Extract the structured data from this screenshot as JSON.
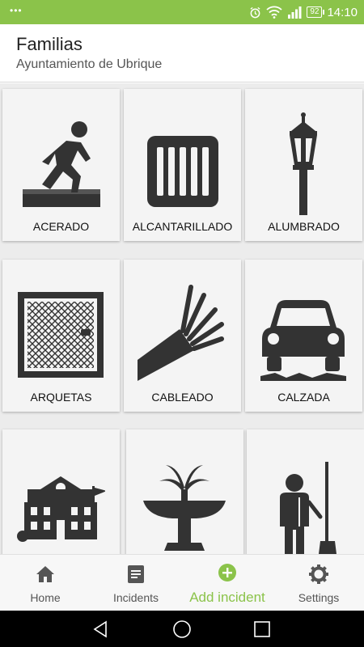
{
  "status_bar": {
    "notification_dots": "•••",
    "battery_level": "92",
    "time": "14:10"
  },
  "header": {
    "title": "Familias",
    "subtitle": "Ayuntamiento de Ubrique"
  },
  "families": [
    {
      "label": "ACERADO",
      "icon": "person-tripping-curb-icon"
    },
    {
      "label": "ALCANTARILLADO",
      "icon": "drain-grate-icon"
    },
    {
      "label": "ALUMBRADO",
      "icon": "street-lamp-icon"
    },
    {
      "label": "ARQUETAS",
      "icon": "manhole-cover-icon"
    },
    {
      "label": "CABLEADO",
      "icon": "cable-icon"
    },
    {
      "label": "CALZADA",
      "icon": "car-pothole-icon"
    },
    {
      "label": "",
      "icon": "school-building-icon"
    },
    {
      "label": "",
      "icon": "fountain-icon"
    },
    {
      "label": "",
      "icon": "street-sweeper-icon"
    }
  ],
  "bottom_nav": {
    "home": "Home",
    "incidents": "Incidents",
    "add_incident": "Add incident",
    "settings": "Settings"
  },
  "colors": {
    "accent": "#8bc34a",
    "icon": "#333333",
    "tile_background": "#f4f4f4"
  }
}
